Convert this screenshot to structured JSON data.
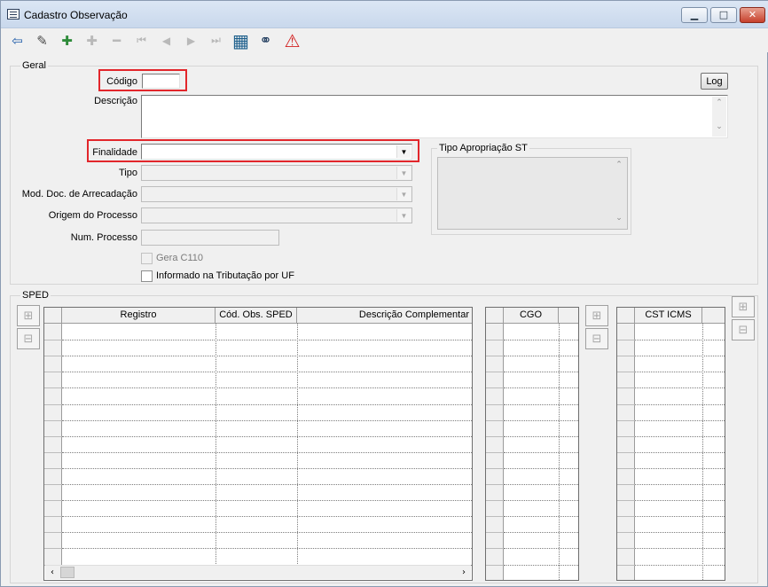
{
  "window": {
    "title": "Cadastro Observação",
    "minimize_glyph": "▁",
    "maximize_glyph": "□",
    "close_glyph": "✕"
  },
  "toolbar": {
    "buttons": [
      {
        "icon": "exit-door-icon",
        "glyph": "⇦",
        "enabled": true
      },
      {
        "icon": "eraser-icon",
        "glyph": "✎",
        "enabled": true
      },
      {
        "icon": "add-record-icon",
        "glyph": "✚",
        "enabled": true
      },
      {
        "icon": "edit-record-icon",
        "glyph": "✚",
        "enabled": false
      },
      {
        "icon": "delete-record-icon",
        "glyph": "━",
        "enabled": false
      },
      {
        "icon": "first-record-icon",
        "glyph": "⏮",
        "enabled": false
      },
      {
        "icon": "prev-record-icon",
        "glyph": "◀",
        "enabled": false
      },
      {
        "icon": "next-record-icon",
        "glyph": "▶",
        "enabled": false
      },
      {
        "icon": "last-record-icon",
        "glyph": "⏭",
        "enabled": false
      },
      {
        "icon": "grid-view-icon",
        "glyph": "▦",
        "enabled": true
      },
      {
        "icon": "binoculars-icon",
        "glyph": "⚭",
        "enabled": true
      },
      {
        "icon": "warning-icon",
        "glyph": "⚠",
        "enabled": true
      }
    ]
  },
  "geral": {
    "group_label": "Geral",
    "codigo_label": "Código",
    "codigo_value": "",
    "log_button": "Log",
    "descricao_label": "Descrição",
    "descricao_value": "",
    "finalidade_label": "Finalidade",
    "finalidade_value": "",
    "tipo_label": "Tipo",
    "tipo_value": "",
    "mod_doc_label": "Mod. Doc. de Arrecadação",
    "mod_doc_value": "",
    "origem_label": "Origem do Processo",
    "origem_value": "",
    "num_processo_label": "Num. Processo",
    "num_processo_value": "",
    "gera_c110_label": "Gera C110",
    "gera_c110_checked": false,
    "informado_label": "Informado na Tributação por UF",
    "informado_checked": false,
    "tipo_apropriacao_label": "Tipo Apropriação ST"
  },
  "sped": {
    "group_label": "SPED",
    "main_grid": {
      "columns": [
        "Registro",
        "Cód. Obs. SPED",
        "Descrição Complementar"
      ]
    },
    "cgo_grid": {
      "columns": [
        "CGO"
      ]
    },
    "cst_grid": {
      "columns": [
        "CST ICMS"
      ]
    }
  },
  "colors": {
    "highlight": "#e2262b",
    "window_bg": "#f0f0f0",
    "titlebar": "#c9d8ec"
  }
}
